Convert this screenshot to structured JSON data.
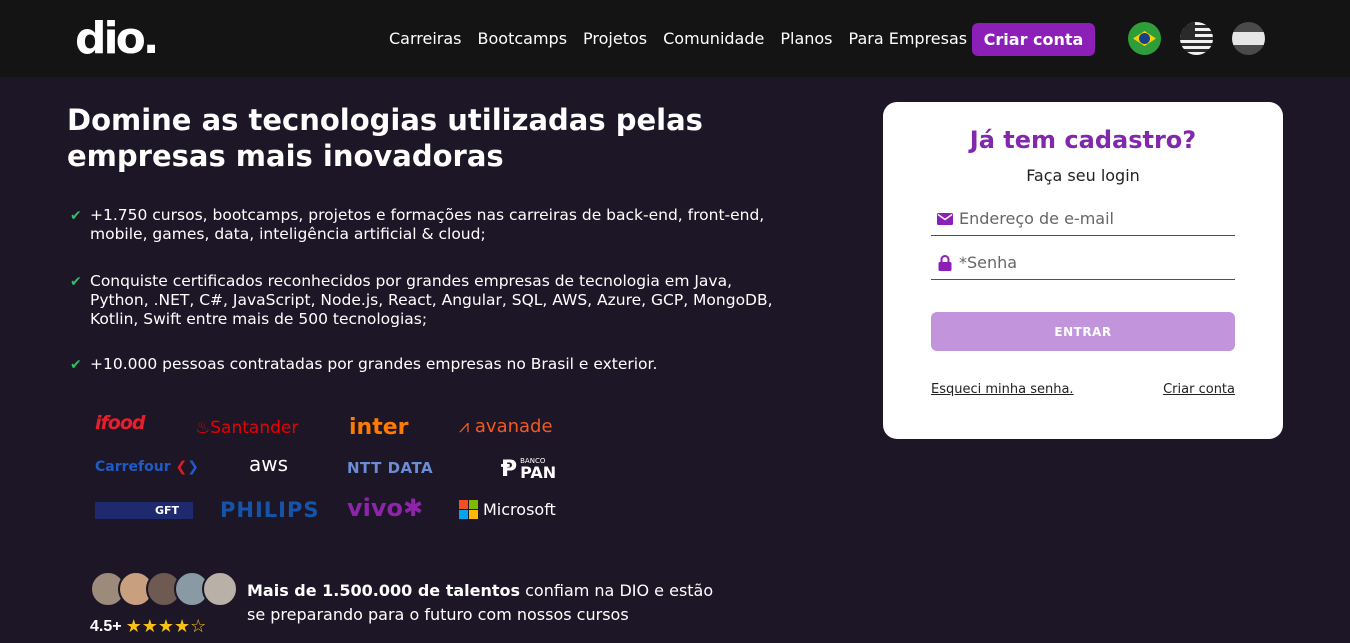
{
  "header": {
    "logo": "dio.",
    "nav": [
      "Carreiras",
      "Bootcamps",
      "Projetos",
      "Comunidade",
      "Planos",
      "Para Empresas"
    ],
    "cta_label": "Criar conta",
    "flags": [
      "brazil-flag-icon",
      "usa-flag-icon",
      "spain-flag-icon"
    ]
  },
  "hero": {
    "title": "Domine as tecnologias utilizadas pelas empresas mais inovadoras",
    "benefits": [
      "+1.750 cursos, bootcamps, projetos e formações nas carreiras de back-end, front-end, mobile, games, data, inteligência artificial & cloud;",
      "Conquiste certificados reconhecidos por grandes empresas de tecnologia em Java, Python, .NET, C#, JavaScript, Node.js, React, Angular, SQL, AWS, Azure, GCP, MongoDB, Kotlin, Swift entre mais de 500 tecnologias;",
      "+10.000 pessoas contratadas por grandes empresas no Brasil e exterior."
    ]
  },
  "logos": {
    "ifood": "ifood",
    "santander": "Santander",
    "inter": "inter",
    "avanade": "avanade",
    "carrefour": "Carrefour",
    "aws": "aws",
    "nttdata": "NTT DATA",
    "bancopan_small": "BANCO",
    "bancopan": "PAN",
    "gft": "GFT",
    "philips": "PHILIPS",
    "vivo": "vivo",
    "microsoft": "Microsoft"
  },
  "social_proof": {
    "rating": "4.5+",
    "stars": "★★★★☆",
    "highlight": "Mais de 1.500.000 de talentos",
    "text": " confiam na DIO e estão se preparando para o futuro com nossos cursos"
  },
  "login": {
    "title": "Já tem cadastro?",
    "subtitle": "Faça seu login",
    "email_placeholder": "Endereço de e-mail",
    "password_placeholder": "*Senha",
    "submit_label": "ENTRAR",
    "forgot_label": "Esqueci minha senha.",
    "create_label": "Criar conta"
  },
  "colors": {
    "brand_purple": "#8c1fb8",
    "background": "#1c1627",
    "header_bg": "#141414",
    "check_green": "#2fbf62"
  }
}
